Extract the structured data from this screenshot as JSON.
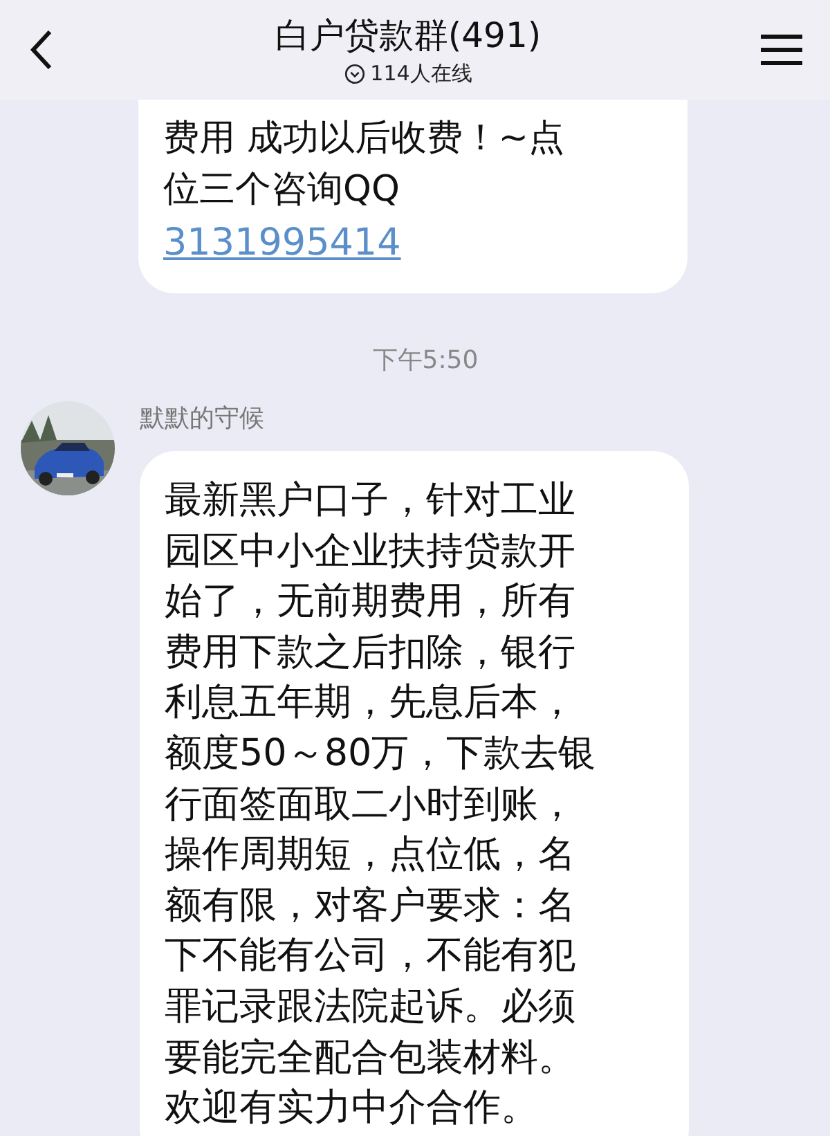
{
  "header": {
    "title": "白户贷款群(491)",
    "online": "114人在线"
  },
  "messages": [
    {
      "kind": "continued",
      "lines": [
        "费用 成功以后收费！~点",
        "位三个咨询QQ"
      ],
      "link": "3131995414"
    },
    {
      "kind": "time",
      "text": "下午5:50"
    },
    {
      "kind": "message",
      "sender": "默默的守候",
      "lines": [
        "最新黑户口子，针对工业",
        "园区中小企业扶持贷款开",
        "始了，无前期费用，所有",
        "费用下款之后扣除，银行",
        "利息五年期，先息后本，",
        "额度50～80万，下款去银",
        "行面签面取二小时到账，",
        "操作周期短，点位低，名",
        "额有限，对客户要求：名",
        "下不能有公司，不能有犯",
        "罪记录跟法院起诉。必须",
        "要能完全配合包装材料。",
        "欢迎有实力中介合作。"
      ]
    }
  ]
}
